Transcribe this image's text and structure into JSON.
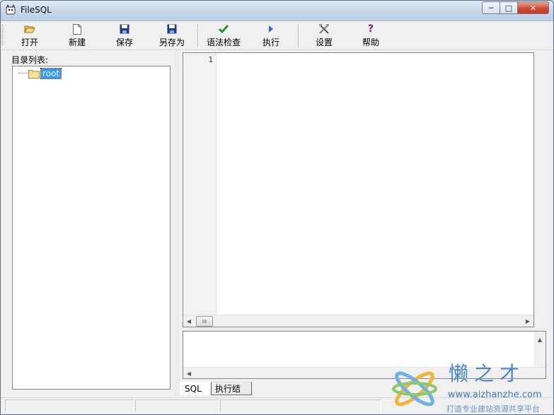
{
  "window": {
    "title": "FileSQL",
    "min_icon": "minimize-icon",
    "max_icon": "maximize-icon",
    "close_icon": "close-icon"
  },
  "toolbar": {
    "buttons": [
      {
        "label": "打开",
        "icon": "open-folder-icon"
      },
      {
        "label": "新建",
        "icon": "new-file-icon"
      },
      {
        "label": "保存",
        "icon": "save-icon"
      },
      {
        "label": "另存为",
        "icon": "save-as-icon"
      },
      {
        "label": "语法检查",
        "icon": "check-icon"
      },
      {
        "label": "执行",
        "icon": "run-arrow-icon"
      },
      {
        "label": "设置",
        "icon": "tools-icon"
      },
      {
        "label": "帮助",
        "icon": "help-icon"
      }
    ]
  },
  "sidebar": {
    "label": "目录列表:",
    "tree": [
      {
        "label": "root",
        "icon": "folder-icon",
        "selected": true
      }
    ]
  },
  "editor": {
    "line_numbers": [
      "1"
    ],
    "content": "",
    "hscroll_thumb": "III"
  },
  "tabs": [
    {
      "label": "SQL",
      "active": true
    },
    {
      "label": "执行结果",
      "active": false
    }
  ],
  "watermark": {
    "brand": "懒之才",
    "url": "www.aizhanzhe.com",
    "slogan": "打造专业建站资源共享平台"
  },
  "colors": {
    "selection": "#3399ff",
    "check_green": "#2e8b2e",
    "save_blue": "#1a3a8a",
    "help_purple": "#8b1a8b",
    "watermark_blue": "#4d85c6"
  }
}
